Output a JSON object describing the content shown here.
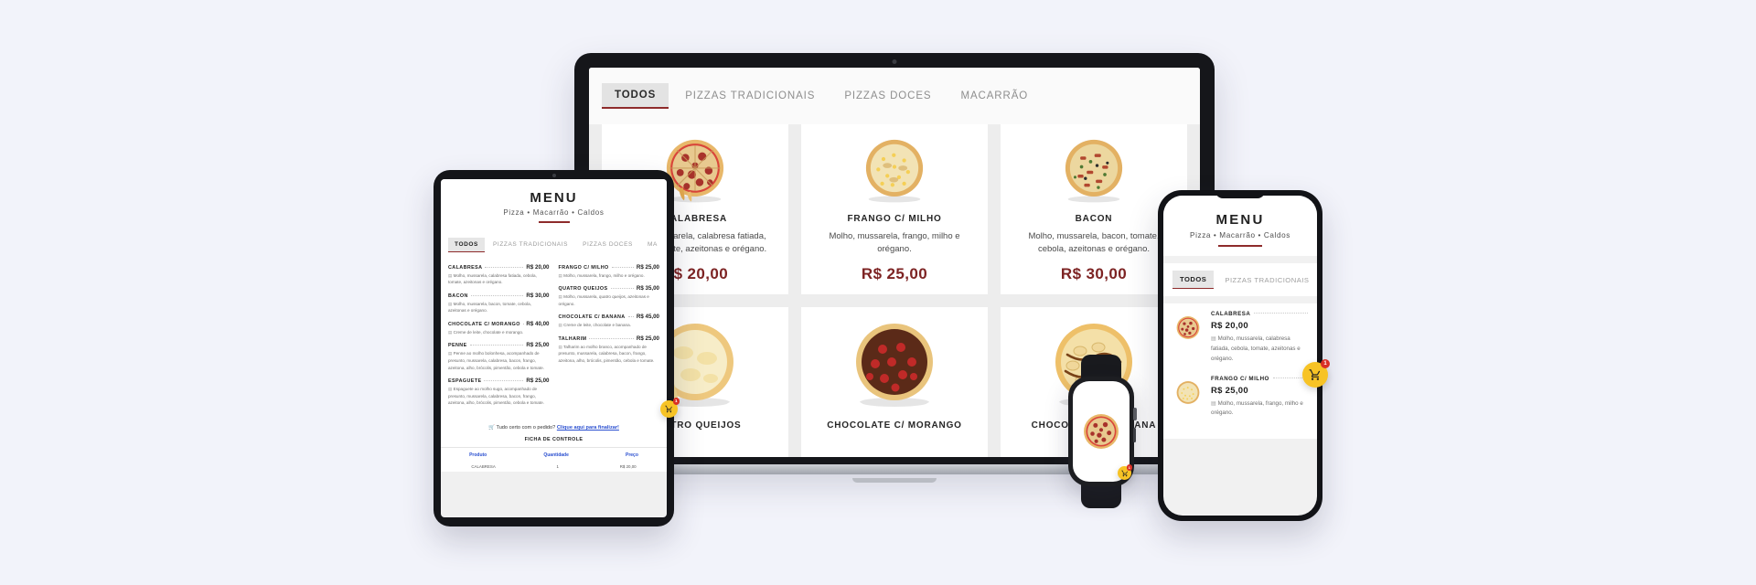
{
  "background_color": "#f2f3fa",
  "brand": {
    "title": "MENU",
    "subtitle": "Pizza • Macarrão • Caldos",
    "accent_color": "#8e2b2b",
    "price_color": "#7d2323",
    "cart_color": "#f7c325",
    "badge_color": "#d93025"
  },
  "laptop": {
    "tabs": [
      {
        "label": "TODOS",
        "active": true
      },
      {
        "label": "PIZZAS TRADICIONAIS",
        "active": false
      },
      {
        "label": "PIZZAS DOCES",
        "active": false
      },
      {
        "label": "MACARRÃO",
        "active": false
      }
    ],
    "cards": [
      {
        "name": "CALABRESA",
        "description": "Molho, mussarela, calabresa fatiada, cebola, tomate, azeitonas e orégano.",
        "price": "R$ 20,00",
        "image": "pizza-calabresa"
      },
      {
        "name": "FRANGO C/ MILHO",
        "description": "Molho, mussarela, frango, milho e orégano.",
        "price": "R$ 25,00",
        "image": "pizza-frango-milho"
      },
      {
        "name": "BACON",
        "description": "Molho, mussarela, bacon, tomate, cebola, azeitonas e orégano.",
        "price": "R$ 30,00",
        "image": "pizza-bacon"
      },
      {
        "name": "QUATRO QUEIJOS",
        "description": "",
        "price": "",
        "image": "pizza-quatro-queijos"
      },
      {
        "name": "CHOCOLATE C/ MORANGO",
        "description": "",
        "price": "",
        "image": "pizza-chocolate-morango"
      },
      {
        "name": "CHOCOLATE C/ BANANA",
        "description": "",
        "price": "",
        "image": "pizza-chocolate-banana"
      }
    ]
  },
  "tablet": {
    "title": "MENU",
    "subtitle": "Pizza • Macarrão • Caldos",
    "tabs": [
      {
        "label": "TODOS",
        "active": true
      },
      {
        "label": "PIZZAS TRADICIONAIS",
        "active": false
      },
      {
        "label": "PIZZAS DOCES",
        "active": false
      },
      {
        "label": "MA",
        "active": false
      }
    ],
    "items_left": [
      {
        "name": "CALABRESA",
        "price": "R$ 20,00",
        "description": "Molho, mussarela, calabresa fatiada, cebola, tomate, azeitonas e orégano."
      },
      {
        "name": "BACON",
        "price": "R$ 30,00",
        "description": "Molho, mussarela, bacon, tomate, cebola, azeitonas e orégano."
      },
      {
        "name": "CHOCOLATE C/ MORANGO",
        "price": "R$ 40,00",
        "description": "Creme de leite, chocolate e morango."
      },
      {
        "name": "PENNE",
        "price": "R$ 25,00",
        "description": "Penne ao molho bolonhesa, acompanhado de presunto, mussarela, calabresa, bacon, frango, azeitona, alho, brócolis, pimentão, cebola e tomate."
      },
      {
        "name": "ESPAGUETE",
        "price": "R$ 25,00",
        "description": "Espaguete ao molho sugo, acompanhado de presunto, mussarela, calabresa, bacon, frango, azeitona, alho, brócolis, pimentão, cebola e tomate."
      }
    ],
    "items_right": [
      {
        "name": "FRANGO C/ MILHO",
        "price": "R$ 25,00",
        "description": "Molho, mussarela, frango, milho e orégano."
      },
      {
        "name": "QUATRO QUEIJOS",
        "price": "R$ 35,00",
        "description": "Molho, mussarela, quatro queijos, azeitonas e orégano."
      },
      {
        "name": "CHOCOLATE C/ BANANA",
        "price": "R$ 45,00",
        "description": "Creme de leite, chocolate e banana."
      },
      {
        "name": "TALHARIM",
        "price": "R$ 25,00",
        "description": "Talharim ao molho branco, acompanhado de presunto, mussarela, calabresa, bacon, frango, azeitona, alho, brócolis, pimentão, cebola e tomate."
      }
    ],
    "cta_text": "Tudo certo com o pedido?",
    "cta_link": "Clique aqui para finalizar!",
    "sheet_title": "FICHA DE CONTROLE",
    "sheet_columns": [
      "Produto",
      "Quantidade",
      "Preço"
    ],
    "sheet_rows": [
      [
        "CALABRESA",
        "1",
        "R$ 20,00"
      ]
    ],
    "cart_badge": "1"
  },
  "phone": {
    "title": "MENU",
    "subtitle": "Pizza • Macarrão • Caldos",
    "tabs": [
      {
        "label": "TODOS",
        "active": true
      },
      {
        "label": "PIZZAS TRADICIONAIS",
        "active": false
      }
    ],
    "items": [
      {
        "name": "CALABRESA",
        "price": "R$ 20,00",
        "description": "Molho, mussarela, calabresa fatiada, cebola, tomate, azeitonas e orégano.",
        "image": "pizza-calabresa"
      },
      {
        "name": "FRANGO C/ MILHO",
        "price": "R$ 25,00",
        "description": "Molho, mussarela, frango, milho e orégano.",
        "image": "pizza-frango-milho"
      }
    ],
    "cart_badge": "1"
  },
  "watch": {
    "image": "pizza-calabresa",
    "cart_badge": "1"
  }
}
